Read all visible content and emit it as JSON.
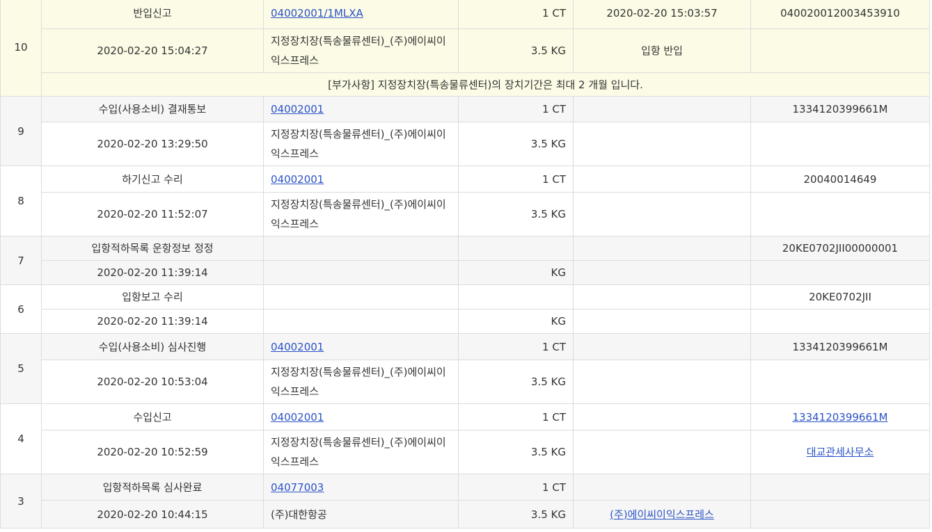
{
  "rows": [
    {
      "no": "10",
      "status": "반입신고",
      "ref": "04002001/1MLXA",
      "qty": "1 CT",
      "col4a": "2020-02-20 15:03:57",
      "col5a": "040020012003453910",
      "datetime": "2020-02-20 15:04:27",
      "place": "지정장치장(특송물류센터)_(주)에이씨이익스프레스",
      "weight": "3.5 KG",
      "col4b": "입항 반입",
      "col5b": "",
      "note": "[부가사항] 지정장치장(특송물류센터)의 장치기간은 최대 2 개월 입니다."
    },
    {
      "no": "9",
      "status": "수입(사용소비) 결재통보",
      "ref": "04002001",
      "qty": "1 CT",
      "col4a": "",
      "col5a": "1334120399661M",
      "datetime": "2020-02-20 13:29:50",
      "place": "지정장치장(특송물류센터)_(주)에이씨이익스프레스",
      "weight": "3.5 KG",
      "col4b": "",
      "col5b": ""
    },
    {
      "no": "8",
      "status": "하기신고 수리",
      "ref": "04002001",
      "qty": "1 CT",
      "col4a": "",
      "col5a": "20040014649",
      "datetime": "2020-02-20 11:52:07",
      "place": "지정장치장(특송물류센터)_(주)에이씨이익스프레스",
      "weight": "3.5 KG",
      "col4b": "",
      "col5b": ""
    },
    {
      "no": "7",
      "status": "입항적하목록 운항정보 정정",
      "ref": "",
      "qty": "",
      "col4a": "",
      "col5a": "20KE0702JII00000001",
      "datetime": "2020-02-20 11:39:14",
      "place": "",
      "weight": "KG",
      "col4b": "",
      "col5b": ""
    },
    {
      "no": "6",
      "status": "입항보고 수리",
      "ref": "",
      "qty": "",
      "col4a": "",
      "col5a": "20KE0702JII",
      "datetime": "2020-02-20 11:39:14",
      "place": "",
      "weight": "KG",
      "col4b": "",
      "col5b": ""
    },
    {
      "no": "5",
      "status": "수입(사용소비) 심사진행",
      "ref": "04002001",
      "qty": "1 CT",
      "col4a": "",
      "col5a": "1334120399661M",
      "datetime": "2020-02-20 10:53:04",
      "place": "지정장치장(특송물류센터)_(주)에이씨이익스프레스",
      "weight": "3.5 KG",
      "col4b": "",
      "col5b": ""
    },
    {
      "no": "4",
      "status": "수입신고",
      "ref": "04002001",
      "qty": "1 CT",
      "col4a": "",
      "col5a": "1334120399661M",
      "datetime": "2020-02-20 10:52:59",
      "place": "지정장치장(특송물류센터)_(주)에이씨이익스프레스",
      "weight": "3.5 KG",
      "col4b": "",
      "col5b": "대교관세사무소"
    },
    {
      "no": "3",
      "status": "입항적하목록 심사완료",
      "ref": "04077003",
      "qty": "1 CT",
      "col4a": "",
      "col5a": "",
      "datetime": "2020-02-20 10:44:15",
      "place": "(주)대한항공",
      "weight": "3.5 KG",
      "col4b": "(주)에이씨이익스프레스",
      "col5b": ""
    }
  ],
  "colors": {
    "link": "#2b53c6",
    "highlight_row": "#fcfbe6",
    "alt_row": "#f6f6f6",
    "border": "#dcdcdc"
  }
}
